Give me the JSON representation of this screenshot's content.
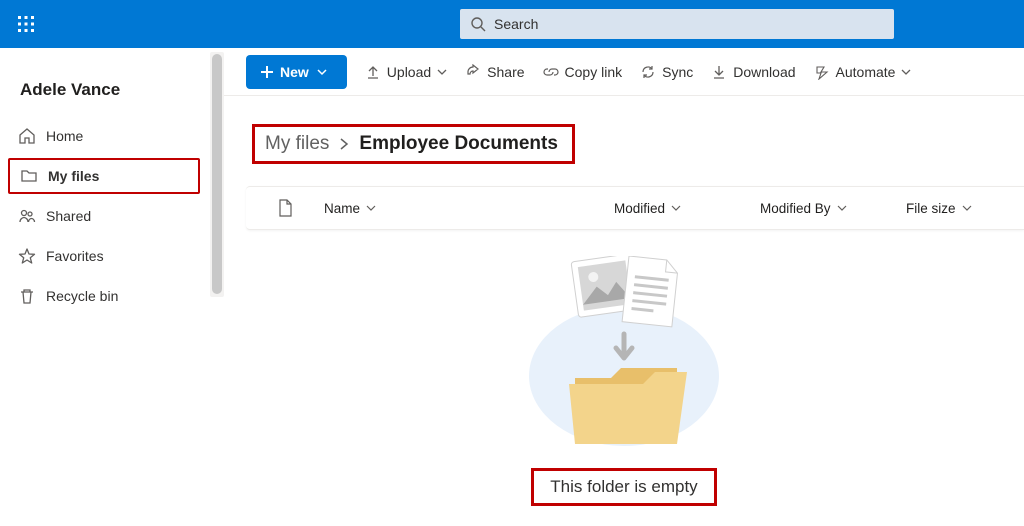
{
  "search": {
    "placeholder": "Search"
  },
  "sidebar": {
    "user": "Adele Vance",
    "items": [
      {
        "label": "Home"
      },
      {
        "label": "My files"
      },
      {
        "label": "Shared"
      },
      {
        "label": "Favorites"
      },
      {
        "label": "Recycle bin"
      }
    ]
  },
  "commands": {
    "new": "New",
    "upload": "Upload",
    "share": "Share",
    "copylink": "Copy link",
    "sync": "Sync",
    "download": "Download",
    "automate": "Automate"
  },
  "breadcrumb": {
    "parent": "My files",
    "current": "Employee Documents"
  },
  "columns": {
    "name": "Name",
    "modified": "Modified",
    "modifiedby": "Modified By",
    "filesize": "File size"
  },
  "empty": {
    "message": "This folder is empty"
  }
}
